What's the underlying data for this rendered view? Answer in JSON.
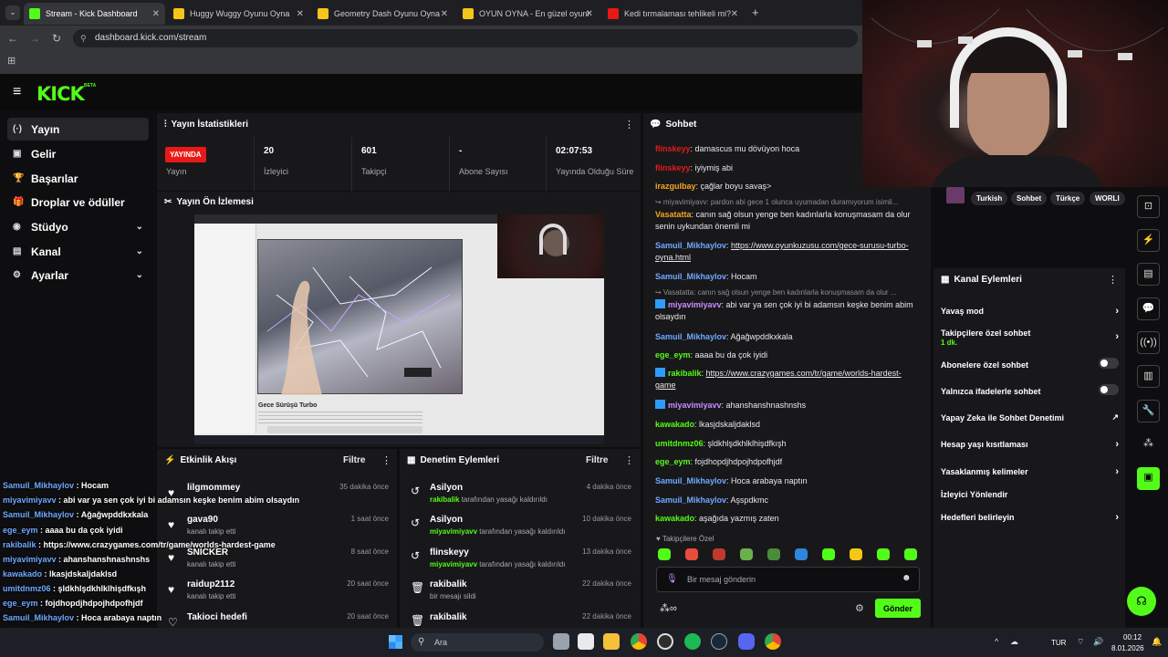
{
  "browser": {
    "tabs": [
      {
        "title": "Stream - Kick Dashboard",
        "active": true,
        "fav": "#53fc18"
      },
      {
        "title": "Huggy Wuggy Oyunu Oyna",
        "fav": "#f5c518"
      },
      {
        "title": "Geometry Dash Oyunu Oyna",
        "fav": "#f5c518"
      },
      {
        "title": "OYUN OYNA - En güzel oyunlar",
        "fav": "#f5c518"
      },
      {
        "title": "Kedi tırmalaması tehlikeli mi? Kı...",
        "fav": "#e91916"
      }
    ],
    "new_tab": "+",
    "url": "dashboard.kick.com/stream"
  },
  "kick": {
    "logo": "KICK",
    "beta": "BETA",
    "colors": {
      "brand": "#53fc18",
      "live": "#e91916"
    }
  },
  "sidebar": {
    "items": [
      {
        "label": "Yayın",
        "icon": "(·)"
      },
      {
        "label": "Gelir",
        "icon": "▣"
      },
      {
        "label": "Başarılar",
        "icon": "🏆"
      },
      {
        "label": "Droplar ve ödüller",
        "icon": "🎁"
      },
      {
        "label": "Stüdyo",
        "icon": "◉"
      },
      {
        "label": "Kanal",
        "icon": "▤"
      },
      {
        "label": "Ayarlar",
        "icon": "⚙"
      }
    ]
  },
  "stats": {
    "title": "Yayın İstatistikleri",
    "live_badge": "YAYINDA",
    "cells": [
      {
        "value": "",
        "label": "Yayın"
      },
      {
        "value": "20",
        "label": "İzleyici"
      },
      {
        "value": "601",
        "label": "Takipçi"
      },
      {
        "value": "-",
        "label": "Abone Sayısı"
      },
      {
        "value": "02:07:53",
        "label": "Yayında Olduğu Süre"
      }
    ]
  },
  "preview": {
    "title": "Yayın Ön İzlemesi",
    "caption": "Gece Sürüşü Turbo"
  },
  "activity": {
    "title": "Etkinlik Akışı",
    "filter": "Filtre",
    "items": [
      {
        "name": "lilgmommey",
        "sub": "",
        "time": "35 dakika önce"
      },
      {
        "name": "gava90",
        "sub": "kanalı takip etti",
        "time": "1 saat önce"
      },
      {
        "name": "SNICKER",
        "sub": "kanalı takip etti",
        "time": "8 saat önce"
      },
      {
        "name": "raidup2112",
        "sub": "kanalı takip etti",
        "time": "20 saat önce"
      },
      {
        "name": "Takioci hedefi",
        "sub": "",
        "time": "20 saat önce"
      }
    ]
  },
  "moderation": {
    "title": "Denetim Eylemleri",
    "filter": "Filtre",
    "items": [
      {
        "name": "Asilyon",
        "by": "rakibalik",
        "rest": "tarafından yasağı kaldırıldı",
        "time": "4 dakika önce",
        "icon": "↺"
      },
      {
        "name": "Asilyon",
        "by": "miyavimiyavv",
        "rest": "tarafından yasağı kaldırıldı",
        "time": "10 dakika önce",
        "icon": "↺"
      },
      {
        "name": "flinskeyy",
        "by": "miyavimiyavv",
        "rest": "tarafından yasağı kaldırıldı",
        "time": "13 dakika önce",
        "icon": "↺"
      },
      {
        "name": "rakibalik",
        "by": "",
        "rest": "bir mesajı sildi",
        "time": "22 dakika önce",
        "icon": "🗑"
      },
      {
        "name": "rakibalik",
        "by": "",
        "rest": "",
        "time": "22 dakika önce",
        "icon": "🗑"
      }
    ]
  },
  "chat": {
    "title": "Sohbet",
    "messages": [
      {
        "user": "flinskeyy",
        "color": "#e91916",
        "text": ": damascus mu dövüyon hoca"
      },
      {
        "user": "flinskeyy",
        "color": "#e91916",
        "text": ": iyiymiş abi"
      },
      {
        "user": "irazgulbay",
        "color": "#f5a623",
        "text": ": çağlar boyu savaş>"
      },
      {
        "system": "↪ miyavimiyavv: pardon abi gece 1 olunca uyumadan duramıyorum isimli..."
      },
      {
        "user": "Vasatatta",
        "color": "#f5a623",
        "text": ": canın sağ olsun yenge ben kadınlarla konuşmasam da olur senin uykundan önemli mi"
      },
      {
        "user": "Samuil_Mikhaylov",
        "color": "#6fa8ff",
        "text": ": ",
        "link": "https://www.oyunkuzusu.com/gece-surusu-turbo-oyna.html"
      },
      {
        "user": "Samuil_Mikhaylov",
        "color": "#6fa8ff",
        "text": ": Hocam"
      },
      {
        "system": "↪ Vasatatta: canın sağ olsun yenge ben kadınlarla konuşmasam da olur ..."
      },
      {
        "user": "miyavimiyavv",
        "color": "#c88cff",
        "text": ": abi var ya sen çok iyi bi adamsın keşke benim abim olsaydın"
      },
      {
        "user": "Samuil_Mikhaylov",
        "color": "#6fa8ff",
        "text": ": Ağağwpddkxkala"
      },
      {
        "user": "ege_eym",
        "color": "#53fc18",
        "text": ": aaaa bu da çok iyidi"
      },
      {
        "user": "rakibalik",
        "color": "#53fc18",
        "text": ": ",
        "link": "https://www.crazygames.com/tr/game/worlds-hardest-game"
      },
      {
        "user": "miyavimiyavv",
        "color": "#c88cff",
        "text": ": ahanshanshnashnshs"
      },
      {
        "user": "kawakado",
        "color": "#53fc18",
        "text": ": lkasjdskaljdaklsd"
      },
      {
        "user": "umitdnmz06",
        "color": "#53fc18",
        "text": ": şldkhlşdkhlklhişdfkışh"
      },
      {
        "user": "ege_eym",
        "color": "#53fc18",
        "text": ": fojdhopdjhdpojhdpofhjdf"
      },
      {
        "user": "Samuil_Mikhaylov",
        "color": "#6fa8ff",
        "text": ": Hoca arabaya naptın"
      },
      {
        "user": "Samuil_Mikhaylov",
        "color": "#6fa8ff",
        "text": ": Aşspdkmc"
      },
      {
        "user": "kawakado",
        "color": "#53fc18",
        "text": ": aşağıda yazmış zaten"
      }
    ],
    "followers_only": "Takipçilere Özel",
    "input_placeholder": "Bir mesaj gönderin",
    "send": "Gönder"
  },
  "overlay_chat": [
    {
      "user": "Samuil_Mikhaylov",
      "text": " : Hocam"
    },
    {
      "user": "miyavimiyavv",
      "text": " : abi var ya sen çok iyi bi adamsın keşke benim abim olsaydın"
    },
    {
      "user": "Samuil_Mikhaylov",
      "text": " : Ağağwpddkxkala"
    },
    {
      "user": "ege_eym",
      "text": " : aaaa bu da çok iyidi"
    },
    {
      "user": "rakibalik",
      "text": " : https://www.crazygames.com/tr/game/worlds-hardest-game"
    },
    {
      "user": "miyavimiyavv",
      "text": " : ahanshanshnashnshs"
    },
    {
      "user": "kawakado",
      "text": " : lkasjdskaljdaklsd"
    },
    {
      "user": "umitdnmz06",
      "text": " : şldkhlşdkhlklhişdfkışh"
    },
    {
      "user": "ege_eym",
      "text": " : fojdhopdjhdpojhdpofhjdf"
    },
    {
      "user": "Samuil_Mikhaylov",
      "text": " : Hoca arabaya naptın"
    },
    {
      "user": "Samuil_Mikhaylov",
      "text": " : Aşspdkmc"
    },
    {
      "user": "kawakado",
      "text": " : aşağıda yazmış zaten"
    }
  ],
  "tags": [
    "Turkish",
    "Sohbet",
    "Türkçe",
    "WORLI"
  ],
  "channel_actions": {
    "title": "Kanal Eylemleri",
    "items": [
      {
        "label": "Yavaş mod",
        "kind": "chevron"
      },
      {
        "label": "Takipçilere özel sohbet",
        "sub": "1 dk.",
        "kind": "chevron"
      },
      {
        "label": "Abonelere özel sohbet",
        "kind": "toggle"
      },
      {
        "label": "Yalnızca ifadelerle sohbet",
        "kind": "toggle"
      },
      {
        "label": "Yapay Zeka ile Sohbet Denetimi",
        "kind": "external"
      },
      {
        "label": "Hesap yaşı kısıtlaması",
        "kind": "chevron"
      },
      {
        "label": "Yasaklanmış kelimeler",
        "kind": "chevron"
      },
      {
        "label": "İzleyici Yönlendir",
        "kind": "none"
      },
      {
        "label": "Hedefleri belirleyin",
        "kind": "chevron"
      }
    ]
  },
  "taskbar": {
    "search": "Ara",
    "lang": "TUR",
    "time": "00:12",
    "date": "8.01.2026"
  }
}
